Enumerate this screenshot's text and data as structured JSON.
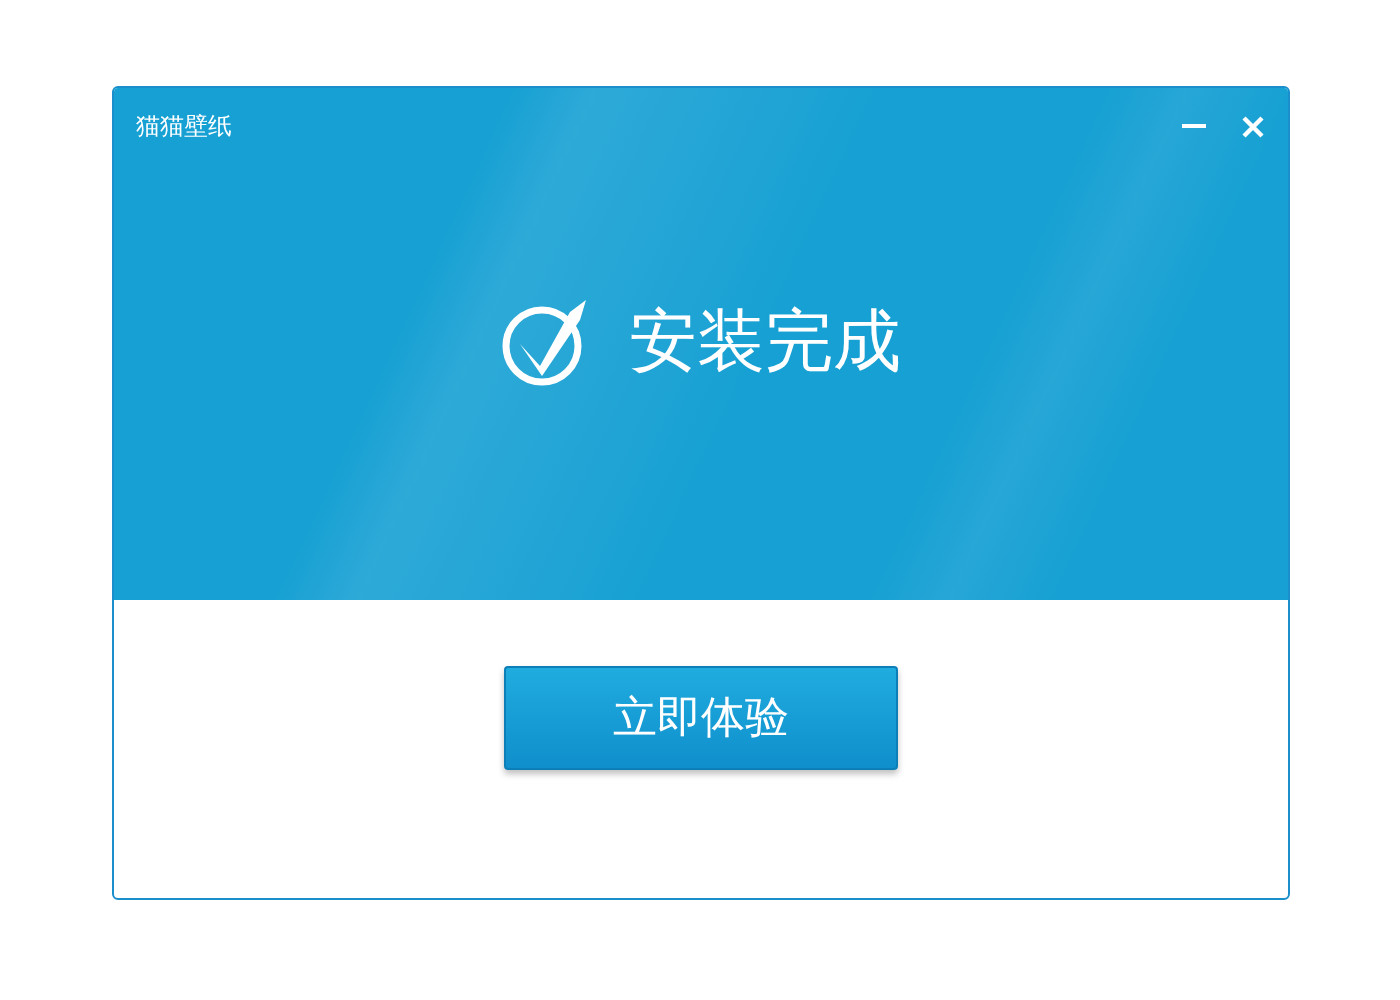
{
  "window": {
    "title": "猫猫壁纸"
  },
  "status": {
    "message": "安装完成"
  },
  "buttons": [
    "立即体验"
  ]
}
